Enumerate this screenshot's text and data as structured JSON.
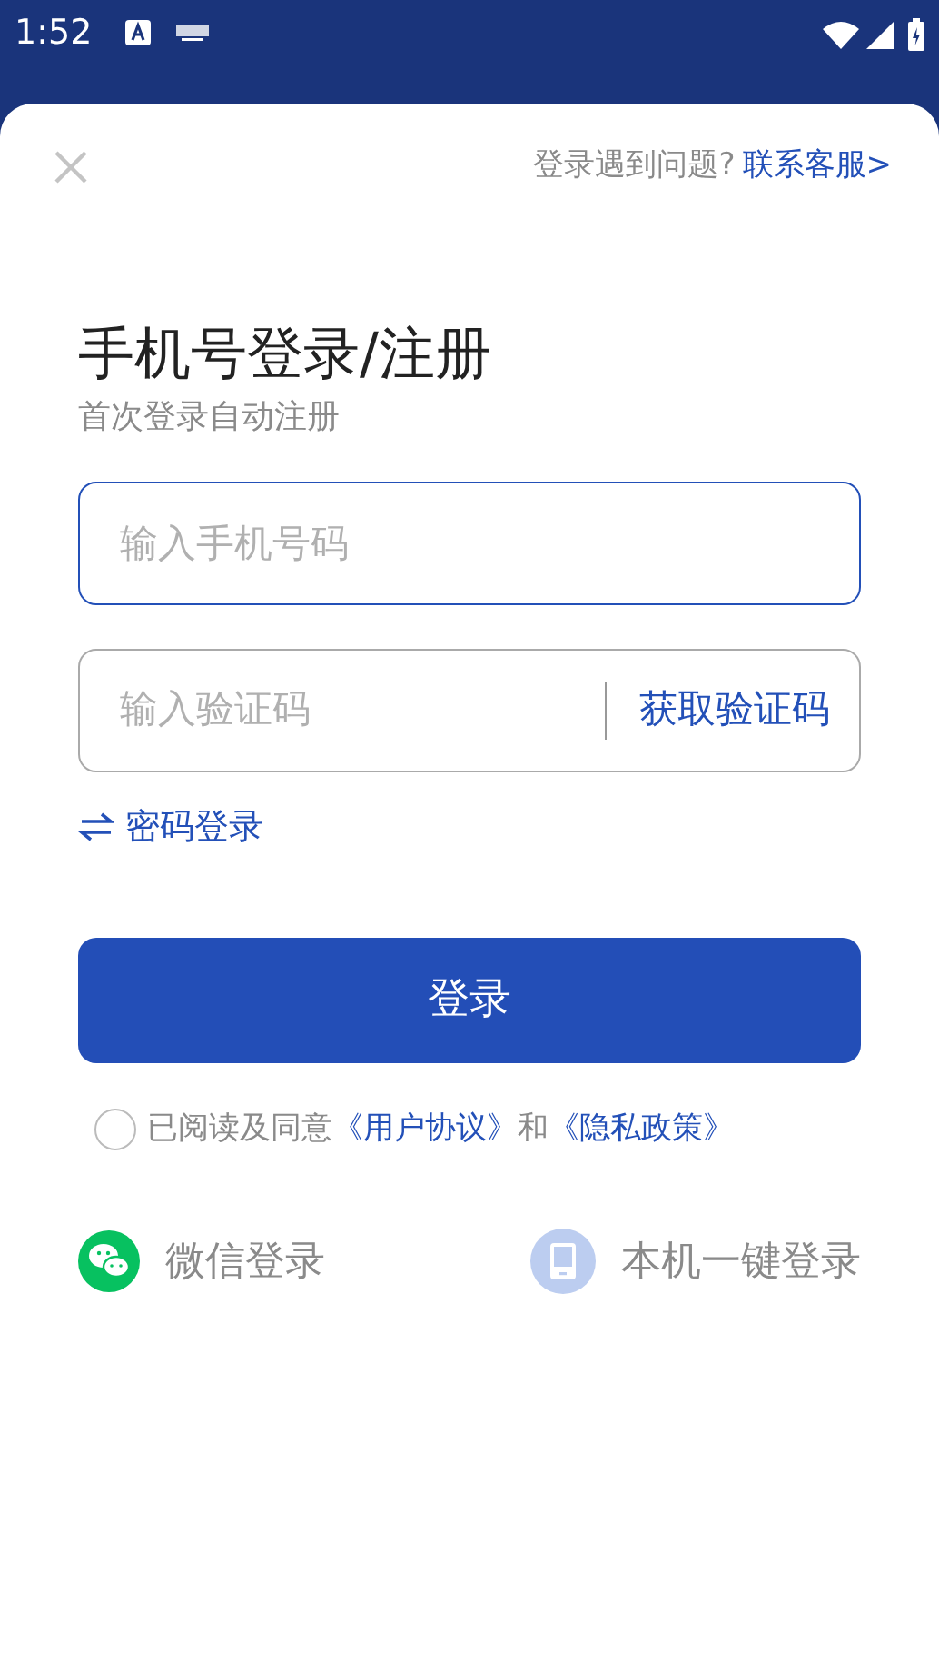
{
  "status_bar": {
    "time": "1:52"
  },
  "header": {
    "help_text": "登录遇到问题?",
    "help_link": "联系客服>"
  },
  "title": "手机号登录/注册",
  "subtitle": "首次登录自动注册",
  "phone_field": {
    "placeholder": "输入手机号码",
    "focused": true
  },
  "code_field": {
    "placeholder": "输入验证码",
    "focused": false,
    "action": "获取验证码"
  },
  "switch_link": "密码登录",
  "login_button": "登录",
  "agreement": {
    "checked": false,
    "parts": [
      {
        "kind": "text",
        "text": "已阅读及同意"
      },
      {
        "kind": "link",
        "text": "《用户协议》"
      },
      {
        "kind": "text",
        "text": "和"
      },
      {
        "kind": "link",
        "text": "《隐私政策》"
      }
    ]
  },
  "alt_logins": [
    {
      "kind": "wechat",
      "label": "微信登录"
    },
    {
      "kind": "device",
      "label": "本机一键登录"
    }
  ]
}
